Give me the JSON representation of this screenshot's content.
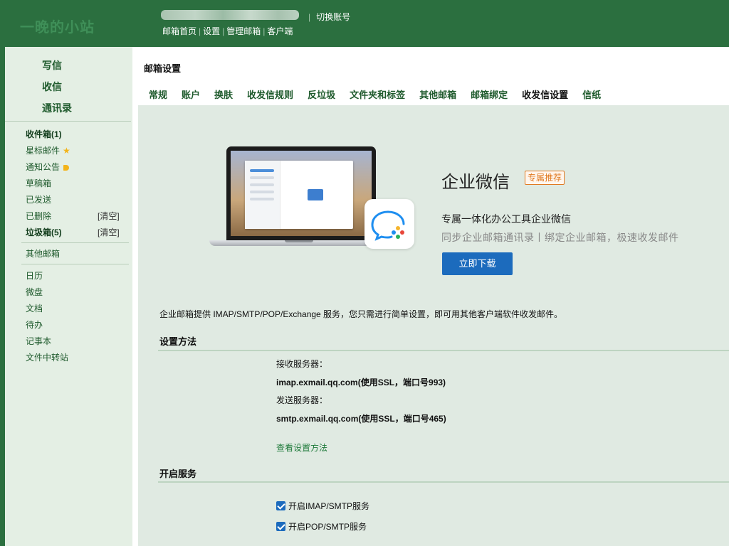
{
  "header": {
    "logo": "一晚的小站",
    "switch_account": "切换账号",
    "nav": [
      "邮箱首页",
      "设置",
      "管理邮箱",
      "客户端"
    ]
  },
  "sidebar": {
    "compose": "写信",
    "inbox_btn": "收信",
    "contacts": "通讯录",
    "folders": [
      {
        "label": "收件箱(1)"
      },
      {
        "label": "星标邮件"
      },
      {
        "label": "通知公告"
      },
      {
        "label": "草稿箱"
      },
      {
        "label": "已发送"
      },
      {
        "label": "已删除",
        "action": "[清空]"
      },
      {
        "label": "垃圾箱(5)",
        "action": "[清空]"
      }
    ],
    "other_mailbox": "其他邮箱",
    "apps": [
      "日历",
      "微盘",
      "文档",
      "待办",
      "记事本",
      "文件中转站"
    ]
  },
  "main": {
    "title": "邮箱设置",
    "tabs": [
      "常规",
      "账户",
      "换肤",
      "收发信规则",
      "反垃圾",
      "文件夹和标签",
      "其他邮箱",
      "邮箱绑定",
      "收发信设置",
      "信纸"
    ],
    "active_tab": "收发信设置",
    "promo": {
      "title": "企业微信",
      "tag": "专属推荐",
      "subtitle": "专属一体化办公工具企业微信",
      "desc": "同步企业邮箱通讯录丨绑定企业邮箱，极速收发邮件",
      "button": "立即下载"
    },
    "intro": "企业邮箱提供 IMAP/SMTP/POP/Exchange 服务，您只需进行简单设置，即可用其他客户端软件收发邮件。",
    "setup": {
      "title": "设置方法",
      "recv_label": "接收服务器：",
      "recv_value": "imap.exmail.qq.com(使用SSL，端口号993)",
      "send_label": "发送服务器：",
      "send_value": "smtp.exmail.qq.com(使用SSL，端口号465)",
      "help_link": "查看设置方法"
    },
    "service": {
      "title": "开启服务",
      "options": [
        {
          "label": "开启IMAP/SMTP服务",
          "checked": true
        },
        {
          "label": "开启POP/SMTP服务",
          "checked": true
        }
      ]
    }
  },
  "colors": {
    "header_bg": "#2b6f3f",
    "sidebar_bg": "#e4efe4",
    "content_bg": "#e0eae2",
    "primary_button": "#1c6bbd",
    "tag_orange": "#e07a22"
  }
}
